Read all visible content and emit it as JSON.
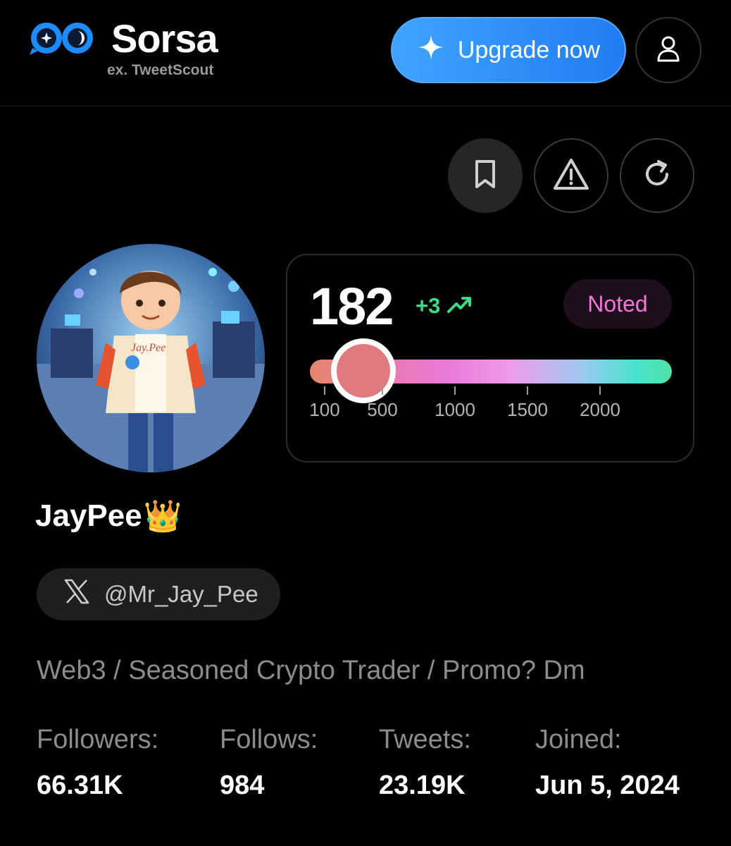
{
  "header": {
    "brand_name": "Sorsa",
    "brand_sub": "ex. TweetScout",
    "upgrade_label": "Upgrade now"
  },
  "icons": {
    "logo": "infinity-eye-logo",
    "upgrade": "sparkle-icon",
    "profile": "user-icon",
    "bookmark": "bookmark-icon",
    "report": "warning-icon",
    "refresh": "refresh-icon",
    "trend": "trend-up-icon",
    "x": "x-logo-icon"
  },
  "score": {
    "value": "182",
    "change": "+3",
    "status": "Noted",
    "scale_ticks": [
      "100",
      "500",
      "1000",
      "1500",
      "2000"
    ]
  },
  "profile": {
    "display_name": "JayPee",
    "crown": "👑",
    "handle": "@Mr_Jay_Pee",
    "bio": "Web3 / Seasoned Crypto Trader / Promo? Dm"
  },
  "stats": [
    {
      "label": "Followers:",
      "value": "66.31K"
    },
    {
      "label": "Follows:",
      "value": "984"
    },
    {
      "label": "Tweets:",
      "value": "23.19K"
    },
    {
      "label": "Joined:",
      "value": "Jun 5, 2024"
    }
  ],
  "colors": {
    "accent_blue": "#1f7df2",
    "positive": "#3ddc84",
    "badge_pink": "#f177d8",
    "muted_text": "#8c8c8c"
  }
}
